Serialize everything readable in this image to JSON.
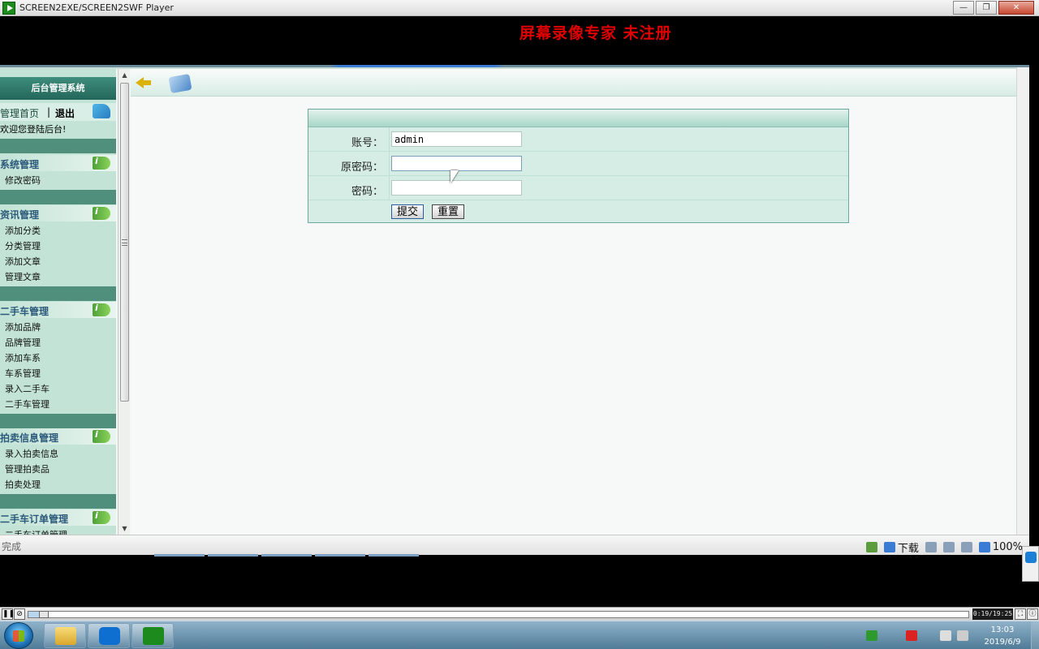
{
  "window": {
    "title": "SCREEN2EXE/SCREEN2SWF Player",
    "minimize": "—",
    "maximize": "❐",
    "close": "✕"
  },
  "watermark": "屏幕录像专家  未注册",
  "left_frame": {
    "header": "后台管理系统",
    "nav_home": "管理首页",
    "nav_separator": "|",
    "nav_logout": "退出",
    "welcome": "欢迎您登陆后台!",
    "menus": [
      {
        "title": "系统管理",
        "items": [
          "修改密码"
        ]
      },
      {
        "title": "资讯管理",
        "items": [
          "添加分类",
          "分类管理",
          "添加文章",
          "管理文章"
        ]
      },
      {
        "title": "二手车管理",
        "items": [
          "添加品牌",
          "品牌管理",
          "添加车系",
          "车系管理",
          "录入二手车",
          "二手车管理"
        ]
      },
      {
        "title": "拍卖信息管理",
        "items": [
          "录入拍卖信息",
          "管理拍卖品",
          "拍卖处理"
        ]
      },
      {
        "title": "二手车订单管理",
        "items": [
          "二手车订单管理"
        ]
      }
    ]
  },
  "form": {
    "account_label": "账号：",
    "account_value": "admin",
    "old_password_label": "原密码：",
    "old_password_value": "",
    "password_label": "密码：",
    "password_value": "",
    "submit_label": "提交",
    "reset_label": "重置"
  },
  "statusbar": {
    "text": "完成",
    "download_label": "下载",
    "zoom": "100%"
  },
  "player": {
    "pause_label": "❚❚",
    "loop_label": "⊘",
    "time": "0:19/19:25",
    "progress_fraction": 0.016
  },
  "taskbar": {
    "apps": [
      {
        "name": "file-explorer"
      },
      {
        "name": "teamviewer"
      },
      {
        "name": "screen2exe-player"
      }
    ],
    "clock_time": "13:03",
    "clock_date": "2019/6/9"
  },
  "colors": {
    "watermark": "#e00000",
    "menu_gap": "#4f8f7c",
    "sidebar_bg": "#c2e3d6",
    "form_bg": "#d5ede4"
  }
}
